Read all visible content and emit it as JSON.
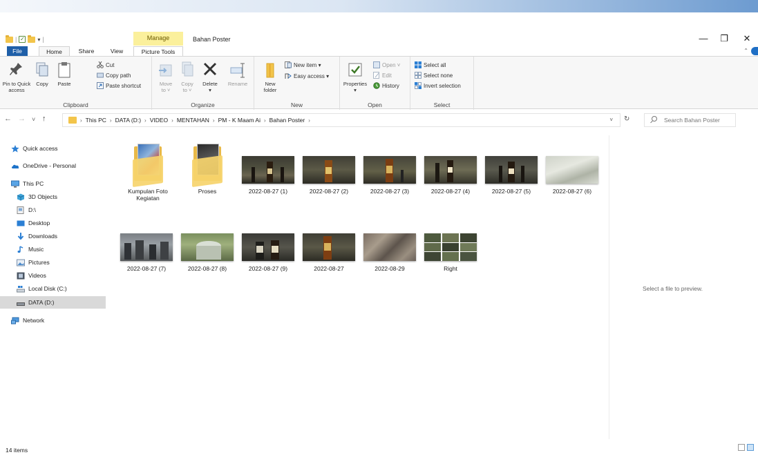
{
  "window": {
    "title": "Bahan Poster",
    "context_tab": "Manage",
    "controls": {
      "minimize": "—",
      "maximize": "❐",
      "close": "✕"
    }
  },
  "ribbon_tabs": {
    "file": "File",
    "home": "Home",
    "share": "Share",
    "view": "View",
    "picture_tools": "Picture Tools"
  },
  "ribbon": {
    "clipboard": {
      "label": "Clipboard",
      "pin_line1": "Pin to Quick",
      "pin_line2": "access",
      "copy": "Copy",
      "paste": "Paste",
      "cut": "Cut",
      "copy_path": "Copy path",
      "paste_shortcut": "Paste shortcut"
    },
    "organize": {
      "label": "Organize",
      "move_to": "Move",
      "move_to_2": "to ˅",
      "copy_to": "Copy",
      "copy_to_2": "to ˅",
      "delete": "Delete",
      "delete_2": "▾",
      "rename": "Rename"
    },
    "new": {
      "label": "New",
      "new_folder": "New",
      "new_folder_2": "folder",
      "new_item": "New item ▾",
      "easy_access": "Easy access ▾"
    },
    "open": {
      "label": "Open",
      "properties": "Properties",
      "properties_2": "▾",
      "open": "Open ˅",
      "edit": "Edit",
      "history": "History"
    },
    "select": {
      "label": "Select",
      "select_all": "Select all",
      "select_none": "Select none",
      "invert_selection": "Invert selection"
    }
  },
  "nav": {
    "back": "←",
    "forward": "→",
    "recent": "˅",
    "up": "↑",
    "breadcrumbs": [
      "This PC",
      "DATA (D:)",
      "VIDEO",
      "MENTAHAN",
      "PM - K Maam Ai",
      "Bahan Poster"
    ],
    "refresh": "↻",
    "dropdown": "˅",
    "search_placeholder": "Search Bahan Poster"
  },
  "nav_pane": {
    "items": [
      {
        "label": "Quick access"
      },
      {
        "label": "OneDrive - Personal"
      },
      {
        "label": "This PC"
      },
      {
        "label": "3D Objects"
      },
      {
        "label": "D:\\"
      },
      {
        "label": "Desktop"
      },
      {
        "label": "Downloads"
      },
      {
        "label": "Music"
      },
      {
        "label": "Pictures"
      },
      {
        "label": "Videos"
      },
      {
        "label": "Local Disk (C:)"
      },
      {
        "label": "DATA (D:)"
      },
      {
        "label": "Network"
      }
    ]
  },
  "files": [
    {
      "name": "Kumpulan Foto Kegiatan",
      "kind": "folder"
    },
    {
      "name": "Proses",
      "kind": "folder"
    },
    {
      "name": "2022-08-27 (1)",
      "kind": "image"
    },
    {
      "name": "2022-08-27 (2)",
      "kind": "image"
    },
    {
      "name": "2022-08-27 (3)",
      "kind": "image"
    },
    {
      "name": "2022-08-27 (4)",
      "kind": "image"
    },
    {
      "name": "2022-08-27 (5)",
      "kind": "image"
    },
    {
      "name": "2022-08-27 (6)",
      "kind": "image"
    },
    {
      "name": "2022-08-27 (7)",
      "kind": "image"
    },
    {
      "name": "2022-08-27 (8)",
      "kind": "image"
    },
    {
      "name": "2022-08-27 (9)",
      "kind": "image"
    },
    {
      "name": "2022-08-27",
      "kind": "image"
    },
    {
      "name": "2022-08-29",
      "kind": "image"
    },
    {
      "name": "Right",
      "kind": "image"
    }
  ],
  "preview": {
    "text": "Select a file to preview."
  },
  "status": {
    "count": "14 items"
  },
  "colors": {
    "accent": "#1f5fa8",
    "manage_tab": "#fbf09c",
    "folder": "#f3c54b",
    "selected_nav": "#d9d9d9"
  }
}
